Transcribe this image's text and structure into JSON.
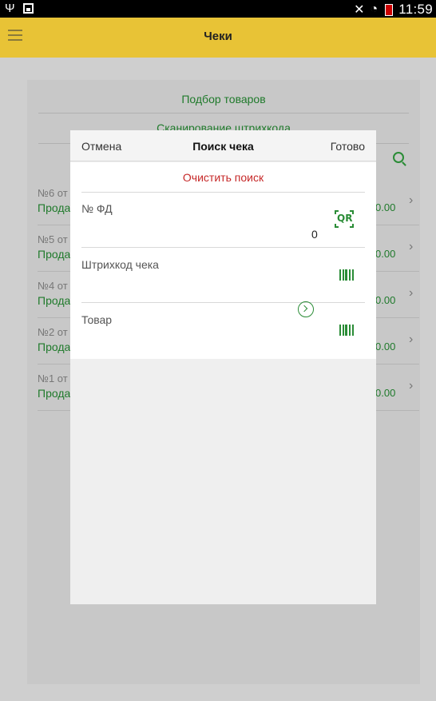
{
  "status_bar": {
    "time": "11:59",
    "usb_symbol": "Ψ"
  },
  "app_bar": {
    "title": "Чеки"
  },
  "background": {
    "select_goods_label": "Подбор товаров",
    "scan_barcodes_label": "Сканирование штрихкода",
    "receipts": [
      {
        "title": "№6 от",
        "type": "Прода",
        "sum": "0.00"
      },
      {
        "title": "№5 от",
        "type": "Прода",
        "sum": "0.00"
      },
      {
        "title": "№4 от",
        "type": "Прода",
        "sum": "0.00"
      },
      {
        "title": "№2 от",
        "type": "Прода",
        "sum": "0.00"
      },
      {
        "title": "№1 от",
        "type": "Прода",
        "sum": "0.00"
      }
    ]
  },
  "dialog": {
    "cancel_label": "Отмена",
    "title": "Поиск чека",
    "done_label": "Готово",
    "clear_search_label": "Очистить поиск",
    "fields": [
      {
        "label": "№ ФД",
        "value": "0"
      },
      {
        "label": "Штрихкод чека",
        "value": ""
      },
      {
        "label": "Товар",
        "value": ""
      }
    ],
    "qr_text": "QR"
  },
  "colors": {
    "accent_green": "#2a8c36",
    "app_bar": "#e8c336",
    "clear_red": "#c62828"
  },
  "icons": [
    "menu-icon",
    "search-icon",
    "qr-code-icon",
    "barcode-icon",
    "circle-arrow-icon",
    "chevron-right-icon"
  ]
}
